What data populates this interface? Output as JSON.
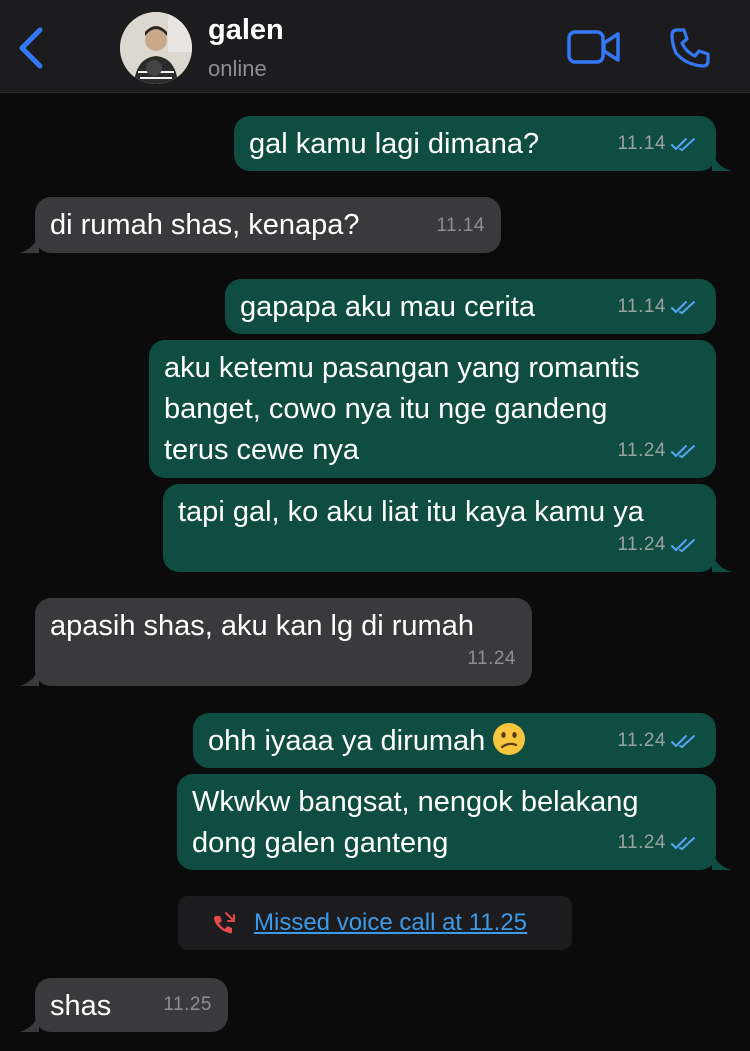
{
  "header": {
    "contact_name": "galen",
    "status": "online",
    "accent_color": "#3478f6"
  },
  "messages": [
    {
      "text": "gal kamu lagi dimana?",
      "time": "11.14",
      "direction": "outgoing",
      "read": true
    },
    {
      "text": "di rumah shas, kenapa?",
      "time": "11.14",
      "direction": "incoming"
    },
    {
      "text": "gapapa aku mau cerita",
      "time": "11.14",
      "direction": "outgoing",
      "read": true
    },
    {
      "text": "aku ketemu pasangan yang romantis\nbanget, cowo nya itu nge gandeng\nterus cewe nya",
      "time": "11.24",
      "direction": "outgoing",
      "read": true
    },
    {
      "text": "tapi gal, ko aku liat itu kaya kamu ya",
      "time": "11.24",
      "direction": "outgoing",
      "read": true
    },
    {
      "text": "apasih shas, aku kan lg di rumah",
      "time": "11.24",
      "direction": "incoming"
    },
    {
      "text": "ohh iyaaa ya dirumah",
      "time": "11.24",
      "direction": "outgoing",
      "read": true,
      "emoji": "confused-face-icon"
    },
    {
      "text": "Wkwkw bangsat, nengok belakang\ndong galen ganteng",
      "time": "11.24",
      "direction": "outgoing",
      "read": true
    },
    {
      "text": "shas",
      "time": "11.25",
      "direction": "incoming"
    }
  ],
  "missed_call": {
    "text": "Missed voice call at 11.25",
    "icon": "missed-call-icon",
    "color": "#e5484d"
  },
  "colors": {
    "outgoing_bubble": "#0f4d43",
    "incoming_bubble": "#3a3a3c",
    "read_ticks": "#53a6f5",
    "background": "#0b0b0b"
  }
}
